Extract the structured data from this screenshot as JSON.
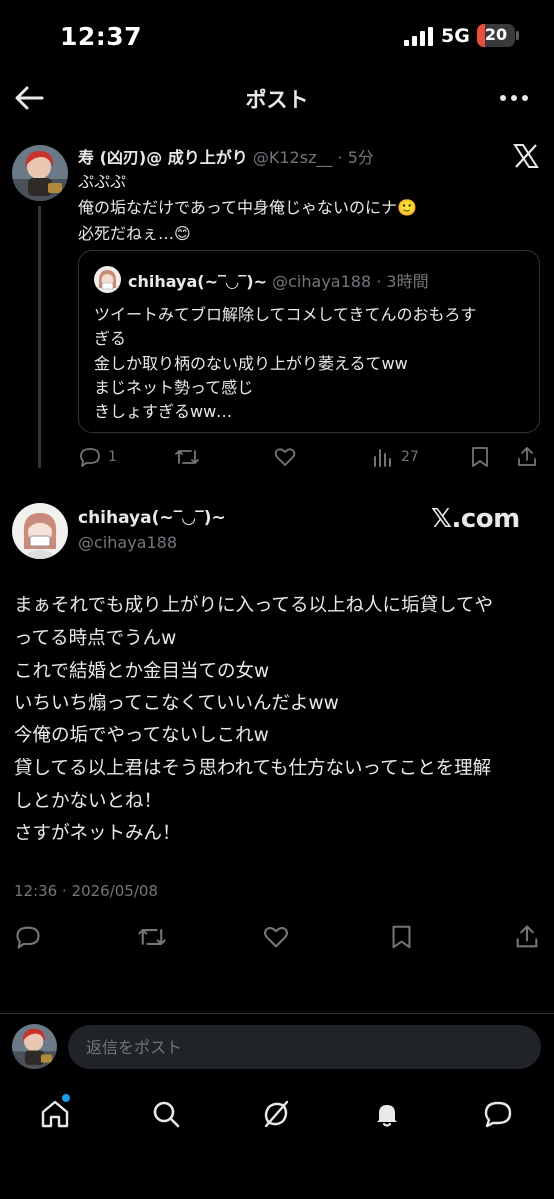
{
  "status_bar": {
    "time": "12:37",
    "network": "5G",
    "battery": "20",
    "battery_level": 0.2
  },
  "header": {
    "title": "ポスト"
  },
  "post": {
    "name": "寿 (凶刃)@ 成り上がり",
    "handle": "@K12sz__",
    "time": "5分",
    "lines": [
      "ぷぷぷ",
      "俺の垢なだけであって中身俺じゃないのにナ🙂",
      "必死だねぇ…😊"
    ],
    "quote": {
      "name": "chihaya(~‾◡‾)~",
      "handle": "@cihaya188",
      "time": "3時間",
      "lines": [
        "ツイートみてブロ解除してコメしてきてんのおもろす",
        "ぎる",
        "金しか取り柄のない成り上がり萎えるてww",
        "まじネット勢って感じ",
        "きしょすぎるww…"
      ]
    },
    "actions": {
      "replies": "1",
      "views": "27"
    }
  },
  "quoted_post": {
    "name": "chihaya(~‾◡‾)~",
    "handle": "@cihaya188",
    "watermark": "𝕏.com",
    "lines": [
      "まぁそれでも成り上がりに入ってる以上ね人に垢貸してや",
      "ってる時点でうんw",
      "これで結婚とか金目当ての女w",
      "いちいち煽ってこなくていいんだよww",
      "今俺の垢でやってないしこれw",
      "貸してる以上君はそう思われても仕方ないってことを理解",
      "しとかないとね！",
      "さすがネットみん！"
    ],
    "timestamp": "12:36 · 2026/05/08"
  },
  "reply_bar": {
    "placeholder": "返信をポスト"
  },
  "colors": {
    "background": "#000000",
    "text": "#e7e9ea",
    "muted": "#71767b",
    "accent": "#1d9bf0",
    "border": "#2f3336"
  }
}
